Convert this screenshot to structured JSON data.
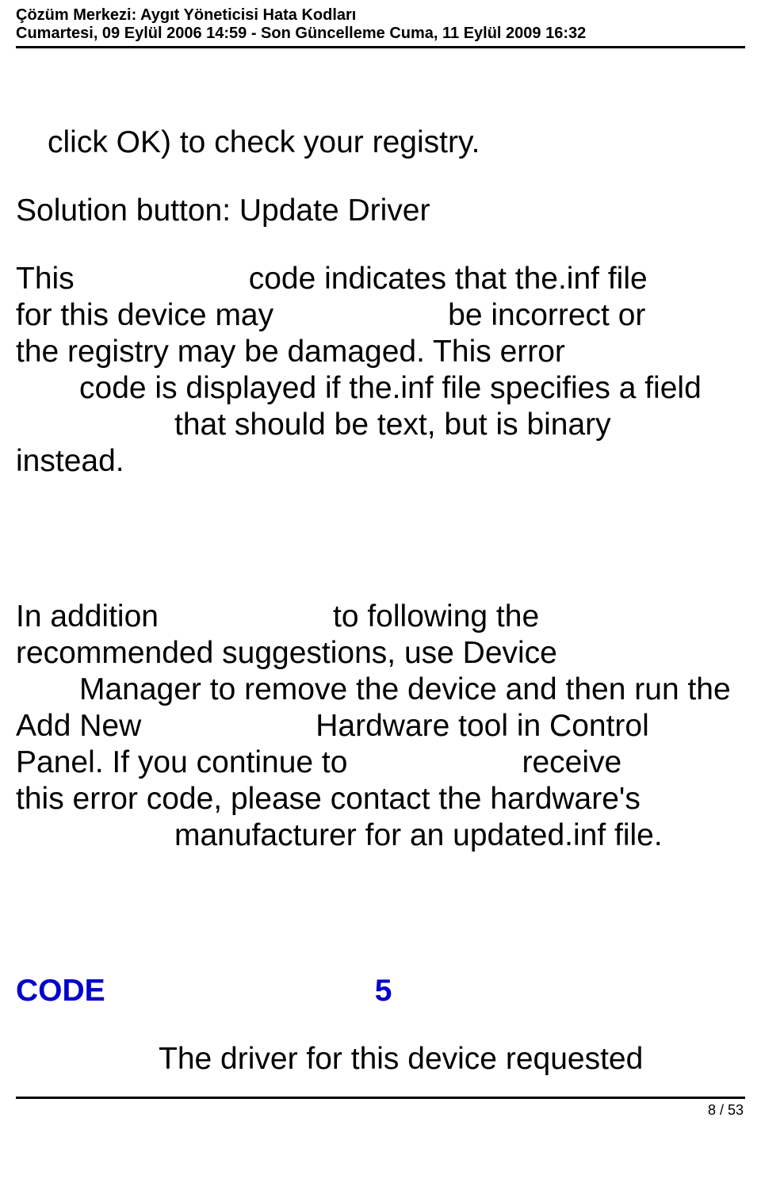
{
  "header": {
    "title": "Çözüm Merkezi: Aygıt Yöneticisi Hata Kodları",
    "dates": "Cumartesi, 09 Eylül 2006 14:59 - Son Güncelleme Cuma, 11 Eylül 2009 16:32"
  },
  "body": {
    "p1": "click OK) to check your registry.",
    "p2": "Solution button: Update Driver",
    "p3a": "This",
    "p3b": "code indicates that the.inf file",
    "p4a": "for this device may",
    "p4b": "be incorrect or",
    "p5": "the registry may be damaged. This error",
    "p6": "code is displayed if the.inf file specifies a field",
    "p7": "that should be text, but is binary",
    "p8": "instead.",
    "p9a": "In addition",
    "p9b": "to following the",
    "p10": "recommended suggestions, use Device",
    "p11": "Manager to remove the device and then run the",
    "p12a": "Add New",
    "p12b": "Hardware tool in Control",
    "p13a": "Panel. If you continue to",
    "p13b": "receive",
    "p14": "this error code, please contact the hardware's",
    "p15": "manufacturer for an updated.inf file.",
    "code_label": "CODE",
    "code_num": "5",
    "code_desc": "The driver for this device requested"
  },
  "footer": {
    "page_num": "8 / 53"
  }
}
